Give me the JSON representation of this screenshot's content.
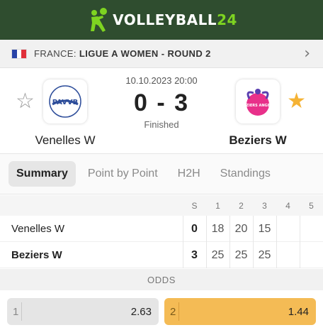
{
  "header": {
    "brand": "VOLLEYBALL",
    "brand_suffix": "24",
    "logo_icon": "volleyball-player-icon",
    "colors": {
      "bar": "#2f4d2f",
      "accent": "#7ed321"
    }
  },
  "league": {
    "country": "FRANCE:",
    "name": "LIGUE A WOMEN - ROUND 2",
    "flag_icon": "france-flag-icon",
    "chevron_icon": "chevron-right-icon"
  },
  "match": {
    "datetime": "10.10.2023 20:00",
    "score": "0 - 3",
    "status": "Finished",
    "home": {
      "name": "Venelles W",
      "logo_text": "PAVVB",
      "favorite": false
    },
    "away": {
      "name": "Beziers W",
      "logo_text": "BEZIERS ANGELS",
      "favorite": true
    }
  },
  "tabs": [
    {
      "label": "Summary",
      "active": true
    },
    {
      "label": "Point by Point",
      "active": false
    },
    {
      "label": "H2H",
      "active": false
    },
    {
      "label": "Standings",
      "active": false
    }
  ],
  "sets": {
    "headers": [
      "S",
      "1",
      "2",
      "3",
      "4",
      "5"
    ],
    "rows": [
      {
        "team": "Venelles W",
        "total": "0",
        "sets": [
          "18",
          "20",
          "15",
          "",
          ""
        ]
      },
      {
        "team": "Beziers W",
        "total": "3",
        "sets": [
          "25",
          "25",
          "25",
          "",
          ""
        ]
      }
    ]
  },
  "odds": {
    "title": "ODDS",
    "items": [
      {
        "label": "1",
        "value": "2.63",
        "highlight": false
      },
      {
        "label": "2",
        "value": "1.44",
        "highlight": true
      }
    ],
    "highlight_color": "#f4bb55"
  }
}
